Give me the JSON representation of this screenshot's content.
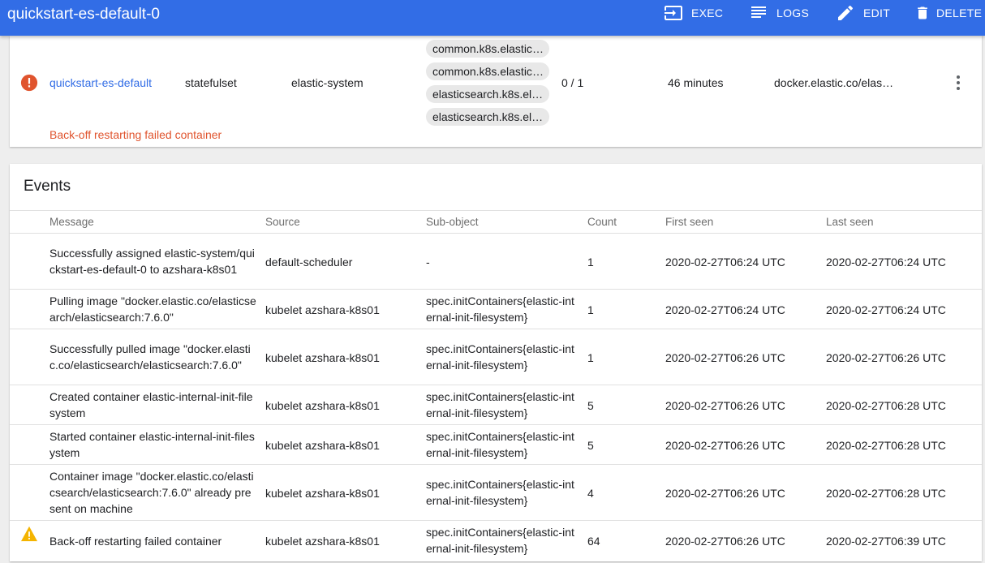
{
  "toolbar": {
    "title": "quickstart-es-default-0",
    "exec_label": "EXEC",
    "logs_label": "LOGS",
    "edit_label": "EDIT",
    "delete_label": "DELETE"
  },
  "pod_row": {
    "name": "quickstart-es-default",
    "kind": "statefulset",
    "namespace": "elastic-system",
    "labels": [
      "common.k8s.elastic.…",
      "common.k8s.elastic.…",
      "elasticsearch.k8s.ela…",
      "elasticsearch.k8s.ela…"
    ],
    "pods": "0 / 1",
    "age": "46 minutes",
    "image": "docker.elastic.co/elas…",
    "error_message": "Back-off restarting failed container",
    "status_icon": "error-icon"
  },
  "events": {
    "title": "Events",
    "columns": {
      "message": "Message",
      "source": "Source",
      "subobject": "Sub-object",
      "count": "Count",
      "first_seen": "First seen",
      "last_seen": "Last seen"
    },
    "rows": [
      {
        "message": "Successfully assigned elastic-system/quickstart-es-default-0 to azshara-k8s01",
        "source": "default-scheduler",
        "subobject": "-",
        "count": "1",
        "first_seen": "2020-02-27T06:24 UTC",
        "last_seen": "2020-02-27T06:24 UTC"
      },
      {
        "message": "Pulling image \"docker.elastic.co/elasticsearch/elasticsearch:7.6.0\"",
        "source": "kubelet azshara-k8s01",
        "subobject": "spec.initContainers{elastic-internal-init-filesystem}",
        "count": "1",
        "first_seen": "2020-02-27T06:24 UTC",
        "last_seen": "2020-02-27T06:24 UTC"
      },
      {
        "message": "Successfully pulled image \"docker.elastic.co/elasticsearch/elasticsearch:7.6.0\"",
        "source": "kubelet azshara-k8s01",
        "subobject": "spec.initContainers{elastic-internal-init-filesystem}",
        "count": "1",
        "first_seen": "2020-02-27T06:26 UTC",
        "last_seen": "2020-02-27T06:26 UTC"
      },
      {
        "message": "Created container elastic-internal-init-filesystem",
        "source": "kubelet azshara-k8s01",
        "subobject": "spec.initContainers{elastic-internal-init-filesystem}",
        "count": "5",
        "first_seen": "2020-02-27T06:26 UTC",
        "last_seen": "2020-02-27T06:28 UTC"
      },
      {
        "message": "Started container elastic-internal-init-filesystem",
        "source": "kubelet azshara-k8s01",
        "subobject": "spec.initContainers{elastic-internal-init-filesystem}",
        "count": "5",
        "first_seen": "2020-02-27T06:26 UTC",
        "last_seen": "2020-02-27T06:28 UTC"
      },
      {
        "message": "Container image \"docker.elastic.co/elasticsearch/elasticsearch:7.6.0\" already present on machine",
        "source": "kubelet azshara-k8s01",
        "subobject": "spec.initContainers{elastic-internal-init-filesystem}",
        "count": "4",
        "first_seen": "2020-02-27T06:26 UTC",
        "last_seen": "2020-02-27T06:28 UTC"
      },
      {
        "message": "Back-off restarting failed container",
        "source": "kubelet azshara-k8s01",
        "subobject": "spec.initContainers{elastic-internal-init-filesystem}",
        "count": "64",
        "first_seen": "2020-02-27T06:26 UTC",
        "last_seen": "2020-02-27T06:39 UTC",
        "icon": "warning-icon"
      }
    ]
  },
  "colors": {
    "toolbar": "#326de6",
    "error": "#e0542e",
    "warning": "#f4b400",
    "link": "#326de6"
  }
}
